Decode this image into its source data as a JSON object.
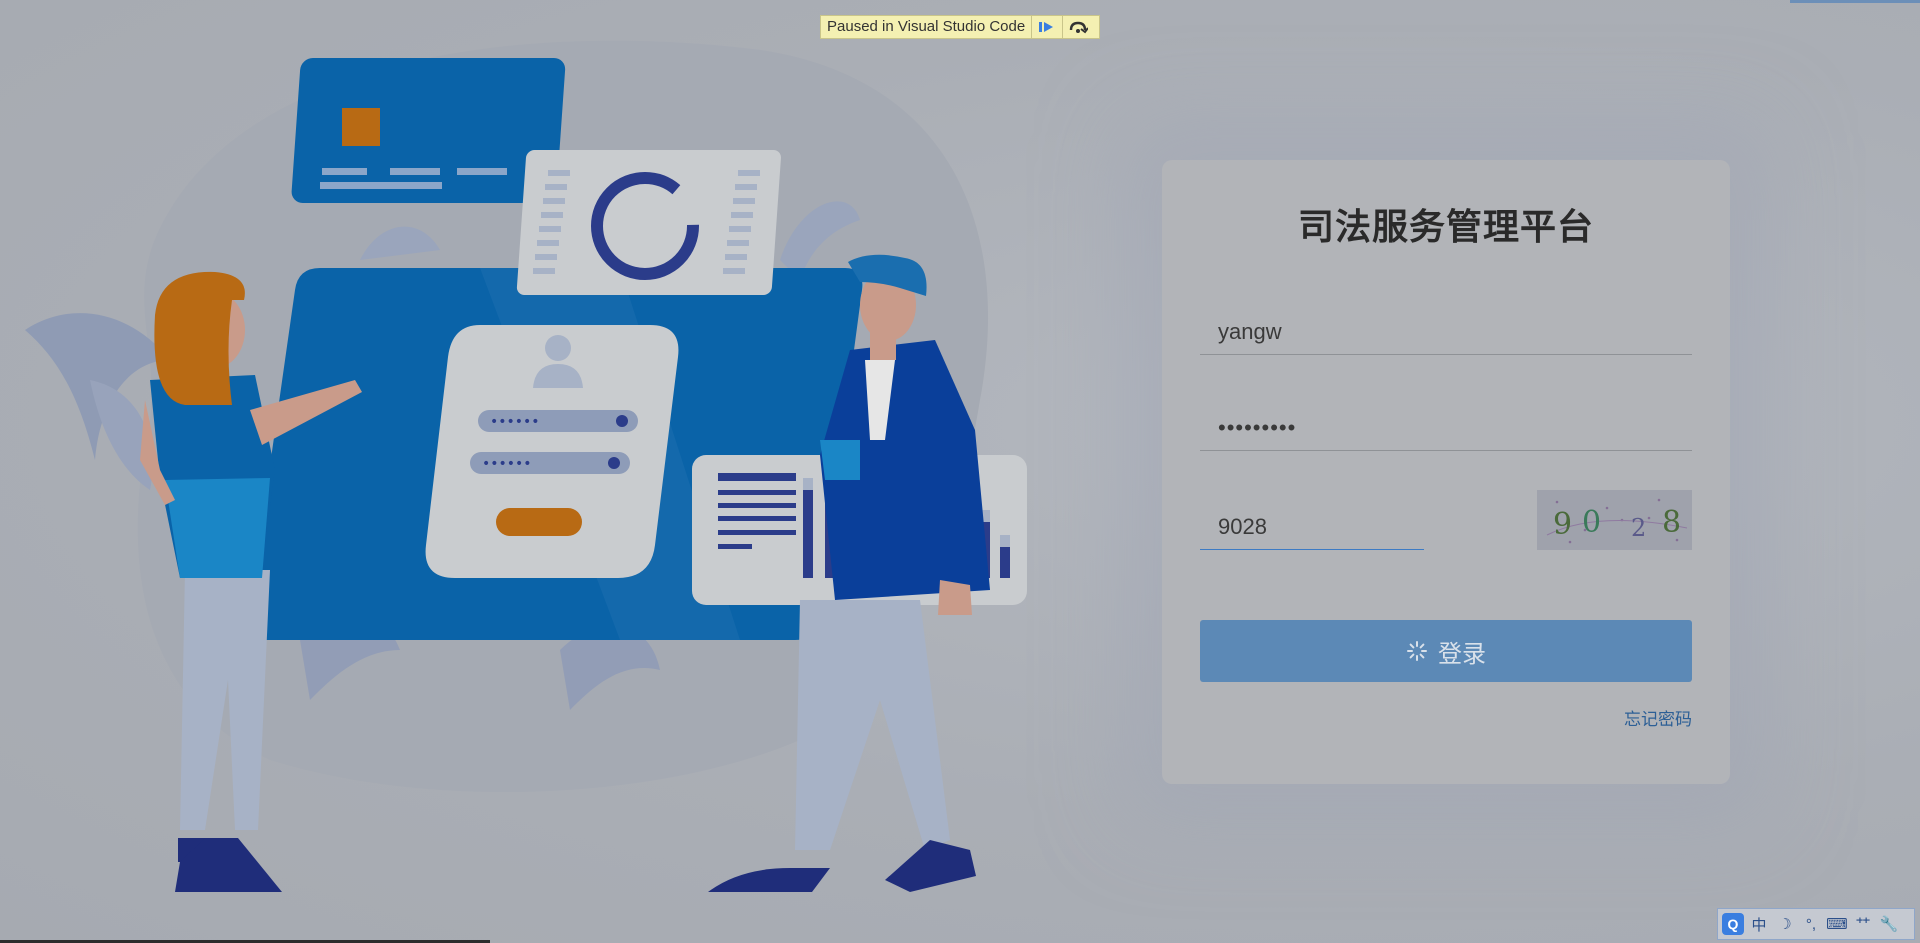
{
  "debugger": {
    "paused_text": "Paused in Visual Studio Code",
    "resume_icon": "resume-icon",
    "step_over_icon": "step-over-icon"
  },
  "login": {
    "title": "司法服务管理平台",
    "username_value": "yangw",
    "password_value": "•••••••••",
    "captcha_value": "9028",
    "captcha_image_text": "9028",
    "login_button_label": "登录",
    "loading_icon": "loading-spinner-icon",
    "forgot_password_label": "忘记密码"
  },
  "ime_toolbar": {
    "items": [
      "Q",
      "中",
      "☽",
      "°,",
      "⌨",
      "⺿",
      "🔧"
    ]
  },
  "colors": {
    "accent_blue": "#5c89b6",
    "link_blue": "#2c5f96",
    "illustration_orange": "#b86a14",
    "illustration_blue": "#0a63a8"
  }
}
